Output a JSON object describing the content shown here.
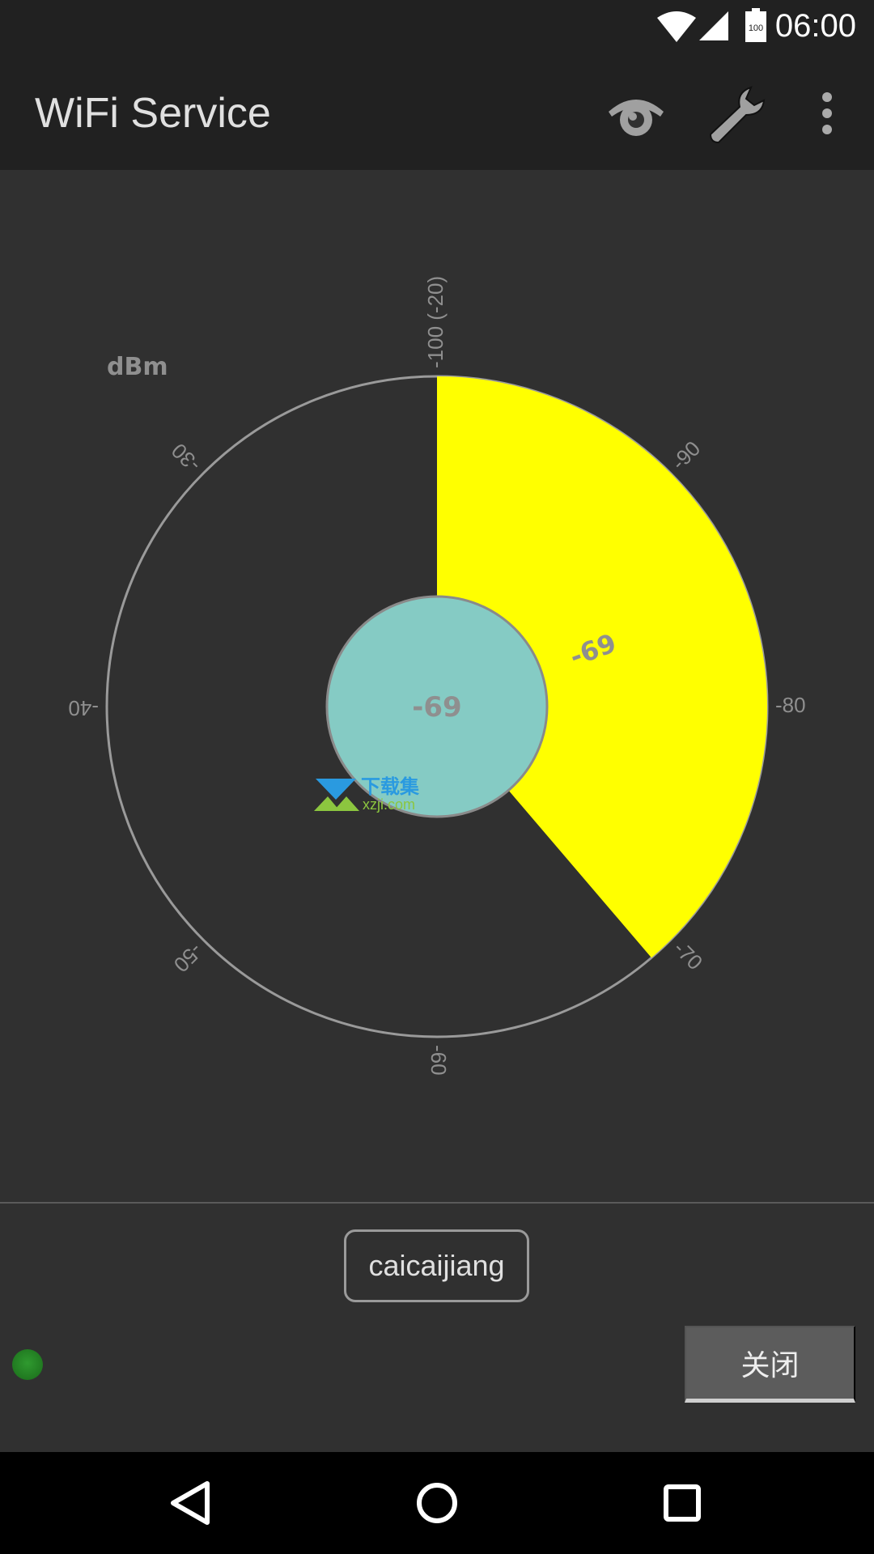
{
  "status_bar": {
    "time": "06:00",
    "battery": "100",
    "icons": [
      "wifi-icon",
      "cell-signal-icon",
      "battery-icon"
    ]
  },
  "app_bar": {
    "title": "WiFi Service",
    "actions": [
      "eye-icon",
      "wrench-icon",
      "more-vert-icon"
    ]
  },
  "gauge": {
    "unit": "dBm",
    "value": -69,
    "value_label": "-69",
    "center_label": "-69",
    "tick_labels": [
      "-100 (-20)",
      "-90",
      "-80",
      "-70",
      "-60",
      "-50",
      "-40",
      "-30"
    ],
    "colors": {
      "fill": "#ffff00",
      "center": "#85cbc4",
      "ring": "#9a9a9a",
      "text": "#8f8f8f"
    }
  },
  "watermark": {
    "text": "下载集",
    "sub": "xzji.com"
  },
  "network": {
    "ssid": "caicaijiang",
    "connected": true,
    "led_color": "#2a8a2a"
  },
  "close_button": {
    "label": "关闭"
  },
  "nav_bar": {
    "buttons": [
      "back-icon",
      "home-icon",
      "recents-icon"
    ]
  }
}
